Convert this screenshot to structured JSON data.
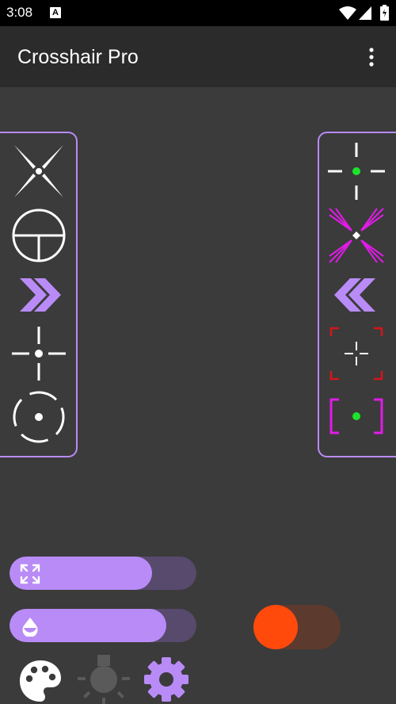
{
  "status_bar": {
    "time": "3:08",
    "badge": "A",
    "icons": [
      "wifi-icon",
      "signal-icon",
      "battery-icon"
    ]
  },
  "app_bar": {
    "title": "Crosshair Pro",
    "menu_icon": "more-vert-icon"
  },
  "left_crosshairs": [
    "x-cross",
    "scope-circle",
    "double-chevron-right",
    "dot-cross",
    "dashed-circle-dot"
  ],
  "right_crosshairs": [
    "green-dot-cross",
    "magenta-arrows-dot",
    "double-chevron-left",
    "red-corner-cross",
    "magenta-bracket-green-dot"
  ],
  "controls": {
    "size_slider": {
      "icon": "expand-icon",
      "value_percent": 76
    },
    "opacity_slider": {
      "icon": "opacity-drop-icon",
      "value_percent": 84
    },
    "toggle": {
      "on": true
    }
  },
  "bottom_icons": [
    "palette-icon",
    "lightbulb-icon",
    "settings-gear-icon"
  ],
  "colors": {
    "accent": "#b98bf7",
    "toggle_accent": "#ff4a0c",
    "background": "#3b3b3b",
    "app_bar": "#2b2b2b"
  }
}
